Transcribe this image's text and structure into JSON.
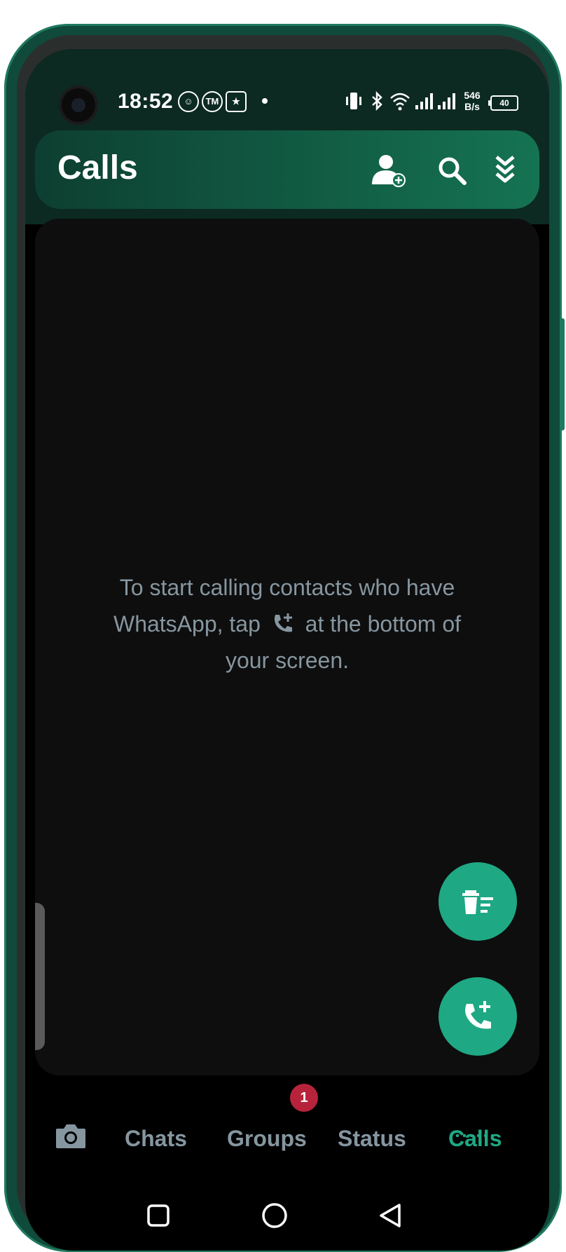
{
  "status_bar": {
    "time": "18:52",
    "network_speed_value": "546",
    "network_speed_unit": "B/s",
    "battery": "40",
    "notification_icons": [
      "baby-face-icon",
      "tm-messenger-icon",
      "star-app-icon"
    ],
    "system_icons": [
      "vibrate-icon",
      "bluetooth-icon",
      "wifi-icon",
      "signal-icon",
      "signal-icon"
    ]
  },
  "app_bar": {
    "title": "Calls",
    "actions": [
      "add-contact-icon",
      "search-icon",
      "chevron-double-down-icon"
    ]
  },
  "empty_state": {
    "text_before": "To start calling contacts who have WhatsApp, tap",
    "text_after": "at the bottom of your screen."
  },
  "fabs": {
    "clear_log_icon": "delete-list-icon",
    "new_call_icon": "add-call-icon"
  },
  "bottom_nav": {
    "camera_icon": "camera-icon",
    "tabs": [
      "Chats",
      "Groups",
      "Status",
      "Calls"
    ],
    "active_tab": "Calls",
    "groups_badge": "1"
  },
  "colors": {
    "accent": "#1fa884",
    "app_bar": "#157352",
    "badge": "#b8233c",
    "muted_text": "#8696a0"
  }
}
